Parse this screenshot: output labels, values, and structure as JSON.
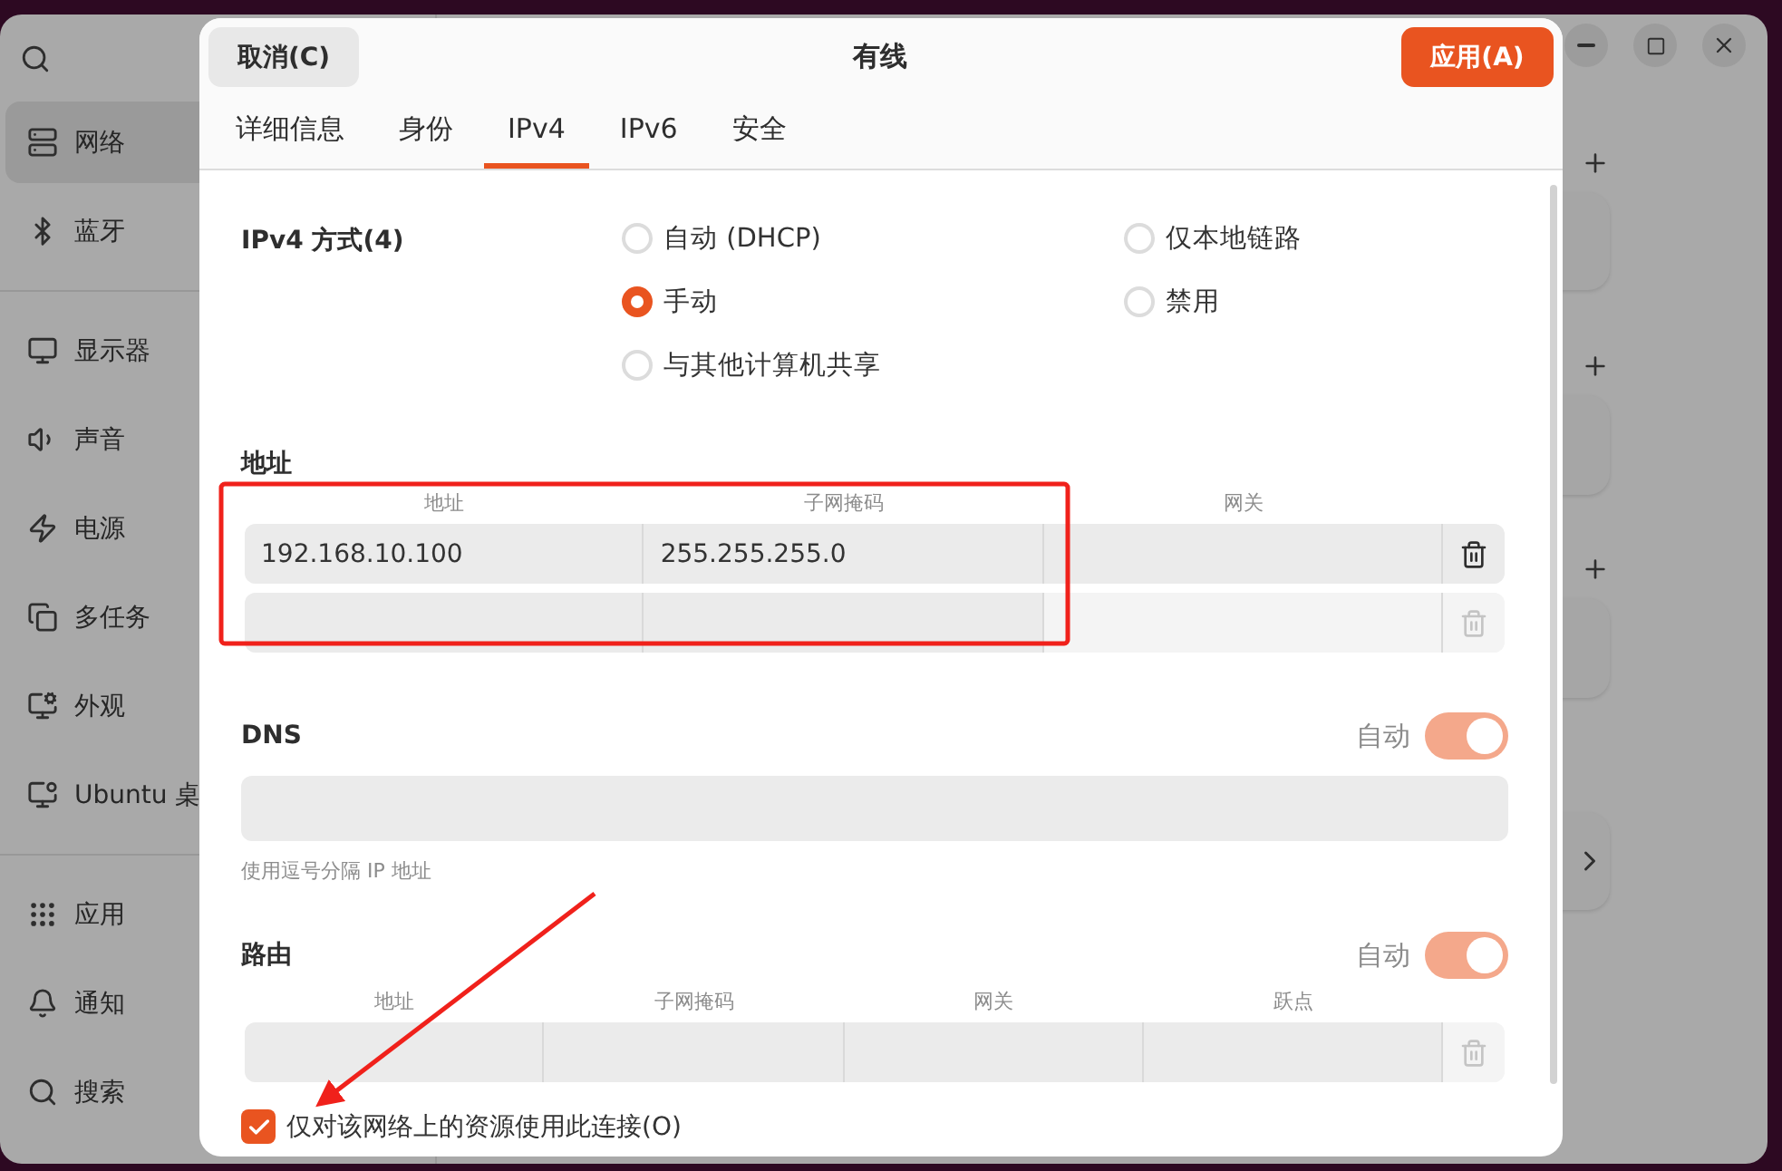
{
  "settings_window": {
    "sidebar": {
      "items": [
        {
          "label": "网络",
          "selected": true,
          "group_end": false
        },
        {
          "label": "蓝牙",
          "selected": false,
          "group_end": true
        },
        {
          "label": "显示器",
          "selected": false,
          "group_end": false
        },
        {
          "label": "声音",
          "selected": false,
          "group_end": false
        },
        {
          "label": "电源",
          "selected": false,
          "group_end": false
        },
        {
          "label": "多任务",
          "selected": false,
          "group_end": false
        },
        {
          "label": "外观",
          "selected": false,
          "group_end": false
        },
        {
          "label": "Ubuntu 桌",
          "selected": false,
          "group_end": true
        },
        {
          "label": "应用",
          "selected": false,
          "group_end": false
        },
        {
          "label": "通知",
          "selected": false,
          "group_end": false
        },
        {
          "label": "搜索",
          "selected": false,
          "group_end": false
        }
      ]
    }
  },
  "dialog": {
    "title": "有线",
    "cancel_button": "取消(C)",
    "apply_button": "应用(A)",
    "tabs": [
      {
        "label": "详细信息",
        "selected": false
      },
      {
        "label": "身份",
        "selected": false
      },
      {
        "label": "IPv4",
        "selected": true
      },
      {
        "label": "IPv6",
        "selected": false
      },
      {
        "label": "安全",
        "selected": false
      }
    ],
    "ipv4_method": {
      "label": "IPv4 方式(4)",
      "options": [
        {
          "label": "自动 (DHCP)",
          "selected": false
        },
        {
          "label": "仅本地链路",
          "selected": false
        },
        {
          "label": "手动",
          "selected": true
        },
        {
          "label": "禁用",
          "selected": false
        },
        {
          "label": "与其他计算机共享",
          "selected": false
        }
      ]
    },
    "addresses": {
      "heading": "地址",
      "columns": [
        "地址",
        "子网掩码",
        "网关"
      ],
      "rows": [
        {
          "address": "192.168.10.100",
          "netmask": "255.255.255.0",
          "deletable": true
        },
        {
          "deletable": false
        }
      ]
    },
    "dns": {
      "heading": "DNS",
      "auto_label": "自动",
      "auto_on": true,
      "hint": "使用逗号分隔 IP 地址"
    },
    "routes": {
      "heading": "路由",
      "auto_label": "自动",
      "auto_on": true,
      "columns": [
        "地址",
        "子网掩码",
        "网关",
        "跃点"
      ],
      "rows": [
        {
          "deletable": false
        }
      ]
    },
    "restrict_option": {
      "label": "仅对该网络上的资源使用此连接(O)",
      "checked": true
    }
  }
}
